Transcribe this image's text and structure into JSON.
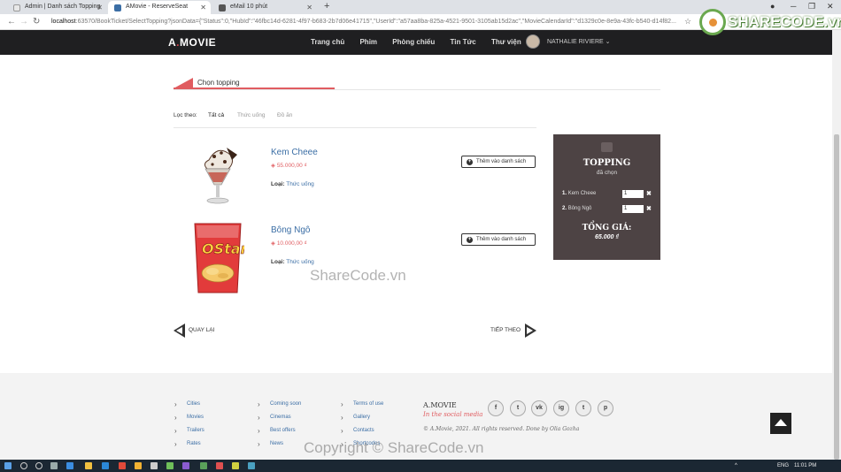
{
  "browser": {
    "tabs": [
      {
        "label": "Admin | Danh sách Topping",
        "icon": "page-icon"
      },
      {
        "label": "AMovie - ReserveSeat",
        "icon": "amovie-icon"
      },
      {
        "label": "eMail 10 phút",
        "icon": "mail-icon"
      }
    ],
    "new_tab": "+",
    "url_host": "localhost",
    "url_rest": ":63570/BookTicket/SelectTopping?jsonData={\"Status\":0,\"HubId\":\"46fbc14d-6281-4f97-b683-2b7d06e41715\",\"UserId\":\"a57aa8ba-825a-4521-9501-3105ab15d2ac\",\"MovieCalendarId\":\"d1329c0e-8e9a-43fc-b540-d14f82..."
  },
  "watermark_logo": "SHARECODE.vn",
  "site": {
    "logo": {
      "prefix": "A",
      "sep": ".",
      "name": "MOVIE"
    },
    "nav": [
      "Trang chủ",
      "Phim",
      "Phòng chiếu",
      "Tin Tức",
      "Thư viện"
    ],
    "user": "NATHALIE RIVIERE"
  },
  "section_title": "Chọn topping",
  "filter": {
    "label": "Lọc theo:",
    "options": [
      "Tất cả",
      "Thức uống",
      "Đồ ăn"
    ]
  },
  "products": [
    {
      "name": "Kem Cheee",
      "price": "55.000,00 ₫",
      "type_label": "Loại:",
      "type": "Thức uống",
      "button": "Thêm vào danh sách"
    },
    {
      "name": "Bông Ngô",
      "price": "10.000,00 ₫",
      "type_label": "Loại:",
      "type": "Thức uống",
      "button": "Thêm vào danh sách"
    }
  ],
  "cart": {
    "title": "TOPPING",
    "subtitle": "đã chọn",
    "items": [
      {
        "num": "1.",
        "name": "Kem Cheee",
        "qty": "1"
      },
      {
        "num": "2.",
        "name": "Bông Ngô",
        "qty": "1"
      }
    ],
    "total_label": "TỔNG GIÁ:",
    "total_value": "65.000 ₫"
  },
  "pager": {
    "back": "QUAY LẠI",
    "next": "TIẾP THEO"
  },
  "watermark": "ShareCode.vn",
  "footer": {
    "col1": [
      "Cities",
      "Movies",
      "Trailers",
      "Rates"
    ],
    "col2": [
      "Coming soon",
      "Cinemas",
      "Best offers",
      "News"
    ],
    "col3": [
      "Terms of use",
      "Gallery",
      "Contacts",
      "Shortcodes"
    ],
    "brand": "A.MOVIE",
    "slogan": "In the social media",
    "copyright": "© A.Movie, 2021. All rights reserved. Done by Olia Gozha",
    "social": [
      "f",
      "t",
      "vk",
      "ig",
      "t",
      "p"
    ]
  },
  "copyright_watermark": "Copyright © ShareCode.vn",
  "taskbar": {
    "lang": "ENG",
    "time": "11:01 PM"
  }
}
